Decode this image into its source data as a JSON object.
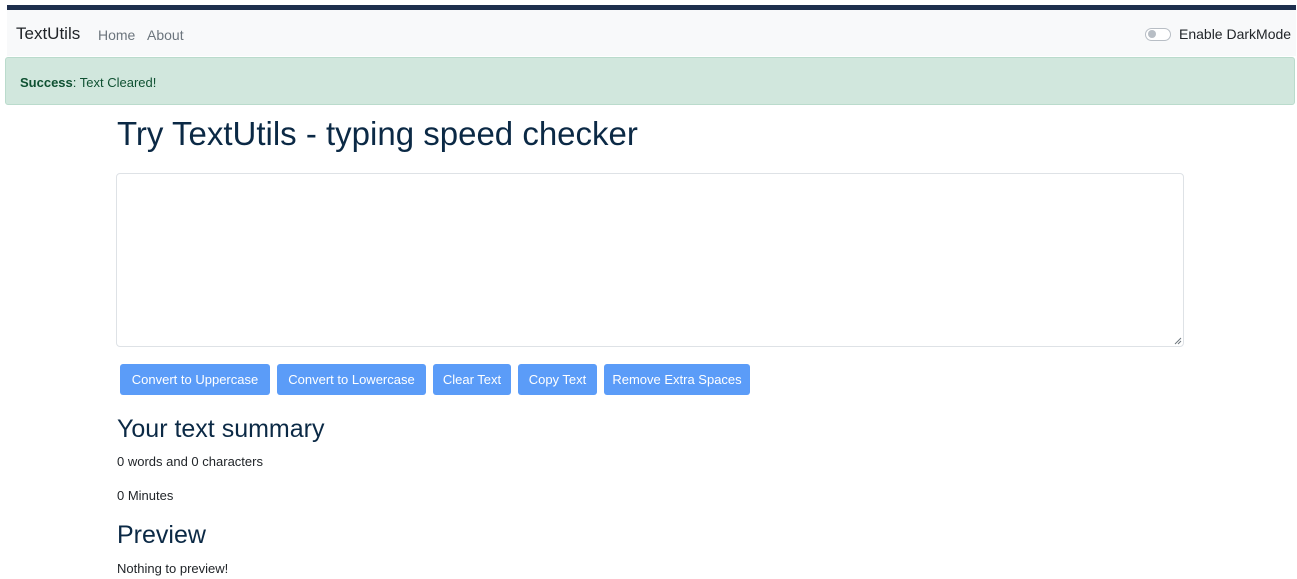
{
  "navbar": {
    "brand": "TextUtils",
    "links": {
      "home": "Home",
      "about": "About"
    },
    "dark_mode_label": "Enable DarkMode",
    "dark_mode_enabled": false
  },
  "alert": {
    "type": "Success",
    "message": ": Text Cleared!"
  },
  "main": {
    "heading": "Try TextUtils - typing speed checker",
    "textarea_value": "",
    "buttons": {
      "uppercase": "Convert to Uppercase",
      "lowercase": "Convert to Lowercase",
      "clear": "Clear Text",
      "copy": "Copy Text",
      "remove_spaces": "Remove Extra Spaces"
    }
  },
  "summary": {
    "title": "Your text summary",
    "counts": "0 words and 0 characters",
    "minutes": "0 Minutes"
  },
  "preview": {
    "title": "Preview",
    "text": "Nothing to preview!"
  },
  "colors": {
    "navbar_top_border": "#1e2f4d",
    "alert_background": "#d1e7dd",
    "button_primary": "#5b9cf8",
    "heading": "#0b2945"
  }
}
